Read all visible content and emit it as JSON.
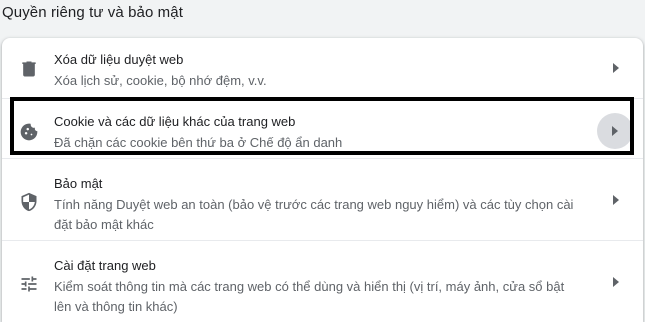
{
  "section": {
    "title": "Quyền riêng tư và bảo mật"
  },
  "rows": [
    {
      "icon": "trash-icon",
      "title": "Xóa dữ liệu duyệt web",
      "subtitle": "Xóa lịch sử, cookie, bộ nhớ đệm, v.v."
    },
    {
      "icon": "cookie-icon",
      "title": "Cookie và các dữ liệu khác của trang web",
      "subtitle": "Đã chặn các cookie bên thứ ba ở Chế độ ẩn danh",
      "highlighted": true
    },
    {
      "icon": "shield-icon",
      "title": "Bảo mật",
      "subtitle": "Tính năng Duyệt web an toàn (bảo vệ trước các trang web nguy hiểm) và các tùy chọn cài đặt bảo mật khác"
    },
    {
      "icon": "tune-icon",
      "title": "Cài đặt trang web",
      "subtitle": "Kiểm soát thông tin mà các trang web có thể dùng và hiển thị (vị trí, máy ảnh, cửa sổ bật lên và thông tin khác)"
    }
  ],
  "colors": {
    "background": "#f1f3f4",
    "card": "#ffffff",
    "highlight_border": "#000000",
    "icon": "#5f6368"
  }
}
